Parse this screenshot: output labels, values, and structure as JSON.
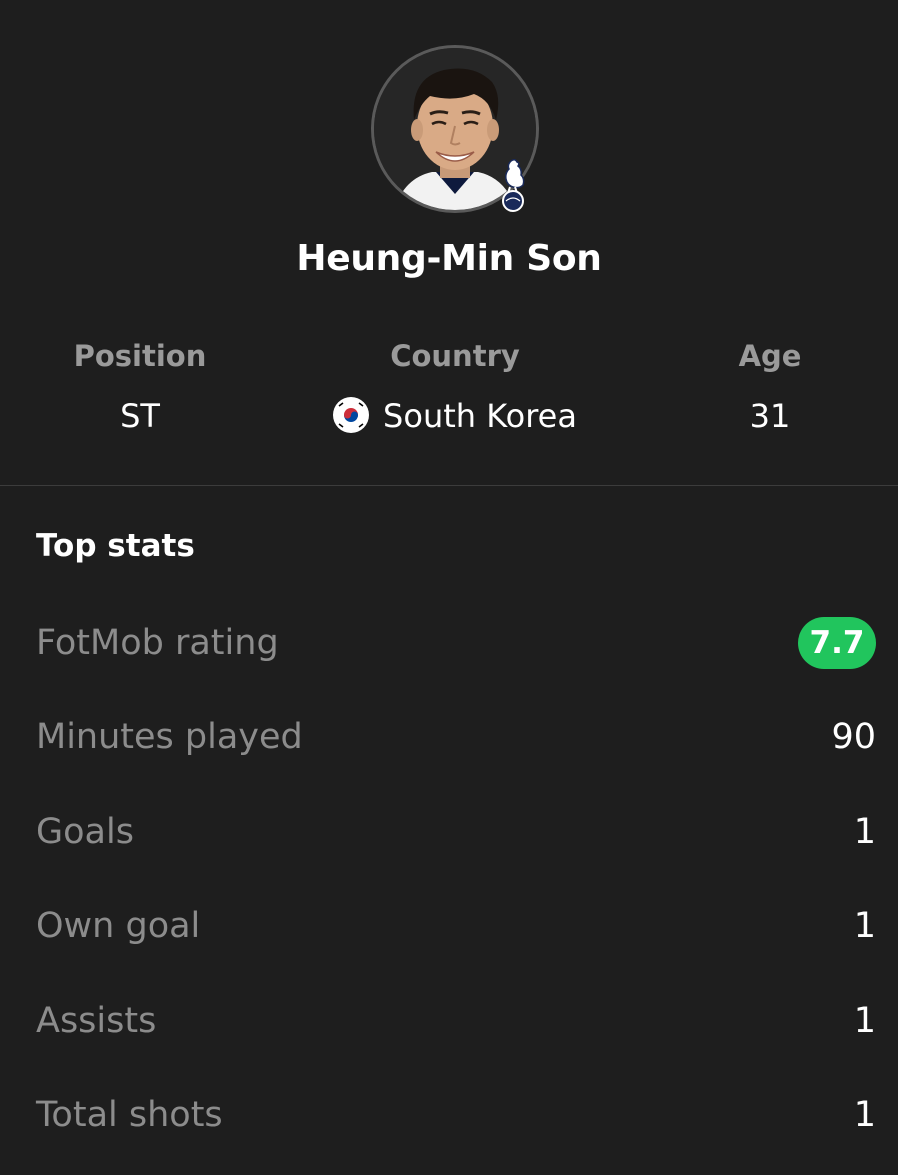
{
  "player": {
    "name": "Heung-Min Son",
    "avatar_icon": "player-photo",
    "club_badge_icon": "tottenham-hotspur-badge"
  },
  "info": {
    "position": {
      "label": "Position",
      "value": "ST"
    },
    "country": {
      "label": "Country",
      "value": "South Korea",
      "flag_icon": "south-korea-flag"
    },
    "age": {
      "label": "Age",
      "value": "31"
    }
  },
  "top_stats": {
    "title": "Top stats",
    "items": [
      {
        "label": "FotMob rating",
        "value": "7.7"
      },
      {
        "label": "Minutes played",
        "value": "90"
      },
      {
        "label": "Goals",
        "value": "1"
      },
      {
        "label": "Own goal",
        "value": "1"
      },
      {
        "label": "Assists",
        "value": "1"
      },
      {
        "label": "Total shots",
        "value": "1"
      }
    ]
  },
  "colors": {
    "background": "#1e1e1e",
    "rating_badge": "#21c55d",
    "label_gray": "#8c8c8c",
    "divider": "#3c3c3c"
  }
}
